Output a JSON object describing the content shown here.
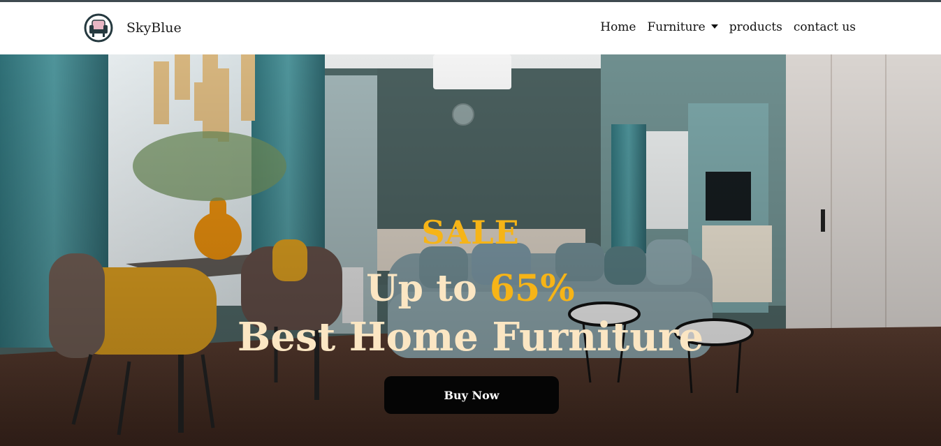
{
  "brand": {
    "name": "SkyBlue",
    "logo_icon": "armchair-logo-icon"
  },
  "nav": {
    "home": "Home",
    "furniture": "Furniture",
    "products": "products",
    "contact": "contact us"
  },
  "hero": {
    "sale": "SALE",
    "upto_prefix": "Up to",
    "upto_percent": "65%",
    "headline": "Best Home Furniture",
    "button": "Buy Now"
  },
  "colors": {
    "accent": "#f6b417",
    "hero_text": "#fbe6c3",
    "button_bg": "#050505"
  }
}
